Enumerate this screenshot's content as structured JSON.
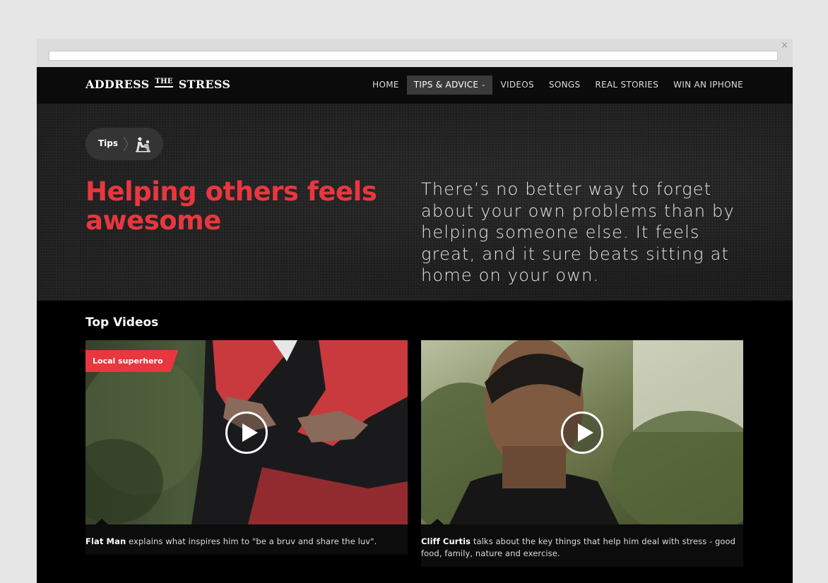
{
  "browser": {
    "close_glyph": "×"
  },
  "logo": {
    "part1": "ADDRESS",
    "part2": "THE",
    "part3": "STRESS"
  },
  "nav": [
    {
      "label": "HOME"
    },
    {
      "label": "TIPS & ADVICE",
      "active": true,
      "caret": "⌄"
    },
    {
      "label": "VIDEOS"
    },
    {
      "label": "SONGS"
    },
    {
      "label": "REAL STORIES"
    },
    {
      "label": "WIN AN IPHONE"
    }
  ],
  "breadcrumb": {
    "label": "Tips",
    "icon": "helping-hands-icon"
  },
  "hero": {
    "headline": "Helping others feels awesome",
    "intro": "There’s no better way to forget about your own problems than by helping someone else. It feels great, and it sure beats sitting at home on your own."
  },
  "section": {
    "title": "Top Videos"
  },
  "videos": [
    {
      "tag": "Local superhero",
      "name": "Flat Man",
      "caption": " explains what inspires him to \"be a bruv and share the luv\"."
    },
    {
      "tag": "",
      "name": "Cliff Curtis",
      "caption": " talks about the key things that help him deal with stress - good food, family, nature and exercise."
    }
  ],
  "colors": {
    "accent": "#e8373f",
    "background": "#000000",
    "hero_bg": "#202020"
  }
}
